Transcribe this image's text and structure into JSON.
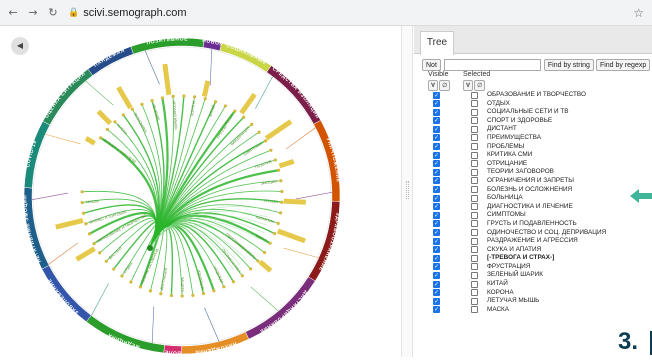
{
  "browser": {
    "back_icon": "←",
    "forward_icon": "→",
    "reload_icon": "↻",
    "lock_icon": "🔒",
    "url": "scivi.semograph.com",
    "star_icon": "☆"
  },
  "viz": {
    "back_icon": "◀",
    "outer_labels": [
      "ПОЗИТИВНОЕ",
      "НОВОЕ",
      "СОЦИАЛЬНЫЕ",
      "СРЕДСТВА ИЗОЛЯЦИИ",
      "УНИЧТОЖЕНИЕ",
      "ЗДРАВООХРАНЕНИЕ",
      "ДИСТАНЦИРОВАНИЕ",
      "НАХОЖДЕНИЕ",
      "БОЛЕ",
      "МЕДИЦИНА",
      "ЗАБОЛЕВАНИЕ",
      "НЕГАТИВНЫЕ ЭМОЦИИ",
      "COVID-19",
      "ОЦЕНКА СИТУАЦИИ",
      "ПАНДЕМИЯ"
    ],
    "inner_labels": [
      "БИЗНЕС И ТОРГОВЛЯ",
      "МАСКИ",
      "ЭКОНОМИКА",
      "ЛЕЧЕНИЕ",
      "ЛЕТУЧАЯ МЫШЬ",
      "КОРОНА",
      "КИТАЙ",
      "ГРУППЫ РИСКА",
      "ВАКЦИНАЦИЯ",
      "СИМПТОМЫ",
      "ПОЗИТИВ",
      "ЭМОЦИИ",
      "УГРОЗА",
      "КАРАНТИН",
      "ВИРУС",
      "ОБЕСПОКОЕННОСТЬ",
      "ПРОФИЛАКТИКА",
      "НАДЕЖДА",
      "ИЗОЛЯЦИЯ",
      "ЗАЩИТА",
      "ДИСТАНЦИЯ",
      "ТЕОРИИ ЗАГОВОРОВ",
      "ОТДЫХ",
      "ДИСТАНТ",
      "ОБРАЗОВАНИЕ И ТВОРЧЕСТВО"
    ],
    "colors": {
      "links": "#2bb52b",
      "bars": "#e6c94a",
      "segments": [
        "#2a9d2a",
        "#6a2d91",
        "#c8d646",
        "#7b1f4a",
        "#d35400",
        "#8b1a1a",
        "#7a2d7a",
        "#e58e26",
        "#d3306f",
        "#2a9d2a",
        "#3355aa",
        "#1e5e8a",
        "#1a8a7a",
        "#2a8a5a",
        "#264c8a"
      ]
    }
  },
  "panel": {
    "tab_label": "Tree",
    "not_label": "Not",
    "filter_value": "",
    "find_string_label": "Find by string",
    "find_regexp_label": "Find by regexp",
    "visible_label": "Visible",
    "selected_label": "Selected",
    "all_btn": "∀",
    "none_btn": "∅",
    "rows": [
      {
        "label": "ОБРАЗОВАНИЕ И ТВОРЧЕСТВО",
        "bold": false
      },
      {
        "label": "ОТДЫХ",
        "bold": false
      },
      {
        "label": "СОЦИАЛЬНЫЕ СЕТИ И ТВ",
        "bold": false
      },
      {
        "label": "СПОРТ И ЗДОРОВЬЕ",
        "bold": false
      },
      {
        "label": "ДИСТАНТ",
        "bold": false
      },
      {
        "label": "ПРЕИМУЩЕСТВА",
        "bold": false
      },
      {
        "label": "ПРОБЛЕМЫ",
        "bold": false
      },
      {
        "label": "КРИТИКА СМИ",
        "bold": false
      },
      {
        "label": "ОТРИЦАНИЕ",
        "bold": false
      },
      {
        "label": "ТЕОРИИ ЗАГОВОРОВ",
        "bold": false
      },
      {
        "label": "ОГРАНИЧЕНИЯ И ЗАПРЕТЫ",
        "bold": false
      },
      {
        "label": "БОЛЕЗНЬ И ОСЛОЖНЕНИЯ",
        "bold": false
      },
      {
        "label": "БОЛЬНИЦА",
        "bold": false
      },
      {
        "label": "ДИАГНОСТИКА И ЛЕЧЕНИЕ",
        "bold": false
      },
      {
        "label": "СИМПТОМЫ",
        "bold": false
      },
      {
        "label": "ГРУСТЬ И ПОДАВЛЕННОСТЬ",
        "bold": false
      },
      {
        "label": "ОДИНОЧЕСТВО И СОЦ. ДЕПРИВАЦИЯ",
        "bold": false
      },
      {
        "label": "РАЗДРАЖЕНИЕ И АГРЕССИЯ",
        "bold": false
      },
      {
        "label": "СКУКА И АПАТИЯ",
        "bold": false
      },
      {
        "label": "[-ТРЕВОГА И СТРАХ-]",
        "bold": true
      },
      {
        "label": "ФРУСТРАЦИЯ",
        "bold": false
      },
      {
        "label": "ЗЕЛЕНЫЙ ШАРИК",
        "bold": false
      },
      {
        "label": "КИТАЙ",
        "bold": false
      },
      {
        "label": "КОРОНА",
        "bold": false
      },
      {
        "label": "ЛЕТУЧАЯ МЫШЬ",
        "bold": false
      },
      {
        "label": "МАСКА",
        "bold": false
      }
    ]
  },
  "annotation": {
    "slide_number": "3.",
    "arrow_color": "#3fb59a"
  }
}
